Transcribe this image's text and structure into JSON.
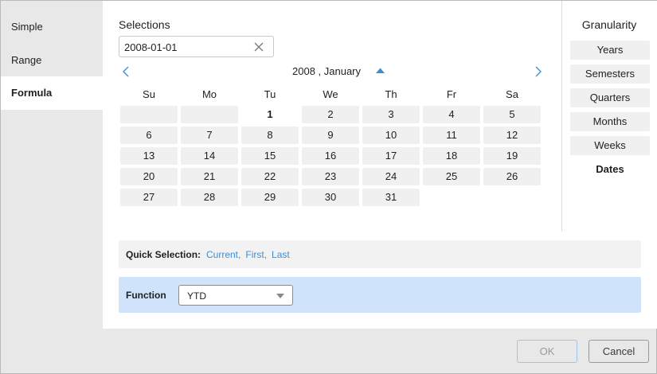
{
  "nav": {
    "items": [
      {
        "label": "Simple",
        "active": false
      },
      {
        "label": "Range",
        "active": false
      },
      {
        "label": "Formula",
        "active": true
      }
    ]
  },
  "selections": {
    "title": "Selections",
    "value": "2008-01-01"
  },
  "calendar": {
    "month_label": "2008 , January",
    "weekdays": [
      "Su",
      "Mo",
      "Tu",
      "We",
      "Th",
      "Fr",
      "Sa"
    ],
    "first_weekday_index": 2,
    "days_in_month": 31,
    "selected_day": "1"
  },
  "granularity": {
    "title": "Granularity",
    "options": [
      {
        "label": "Years",
        "active": false
      },
      {
        "label": "Semesters",
        "active": false
      },
      {
        "label": "Quarters",
        "active": false
      },
      {
        "label": "Months",
        "active": false
      },
      {
        "label": "Weeks",
        "active": false
      },
      {
        "label": "Dates",
        "active": true
      }
    ]
  },
  "quick_selection": {
    "label": "Quick Selection:",
    "links": [
      "Current",
      "First",
      "Last"
    ]
  },
  "function": {
    "label": "Function",
    "value": "YTD"
  },
  "footer": {
    "ok_label": "OK",
    "cancel_label": "Cancel"
  },
  "colors": {
    "accent": "#3a8fd9",
    "function_bg": "#cfe4fb",
    "cell_bg": "#f0f0f0"
  }
}
